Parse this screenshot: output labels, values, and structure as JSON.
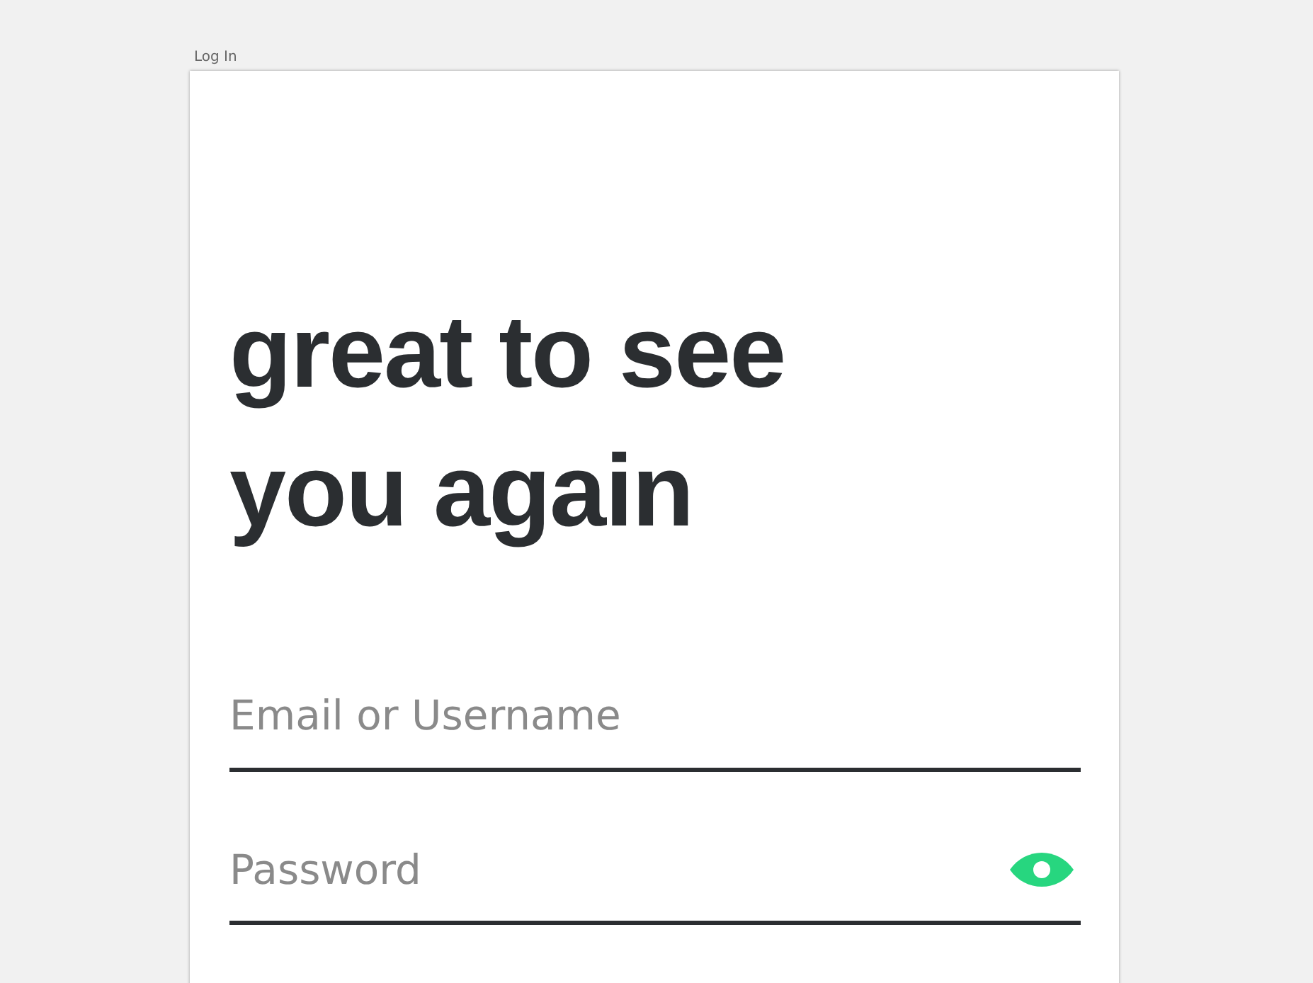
{
  "page_label": "Log In",
  "heading": "great to see you again",
  "fields": [
    {
      "placeholder": "Email or Username",
      "reveal_toggle": false
    },
    {
      "placeholder": "Password",
      "reveal_toggle": true
    }
  ]
}
